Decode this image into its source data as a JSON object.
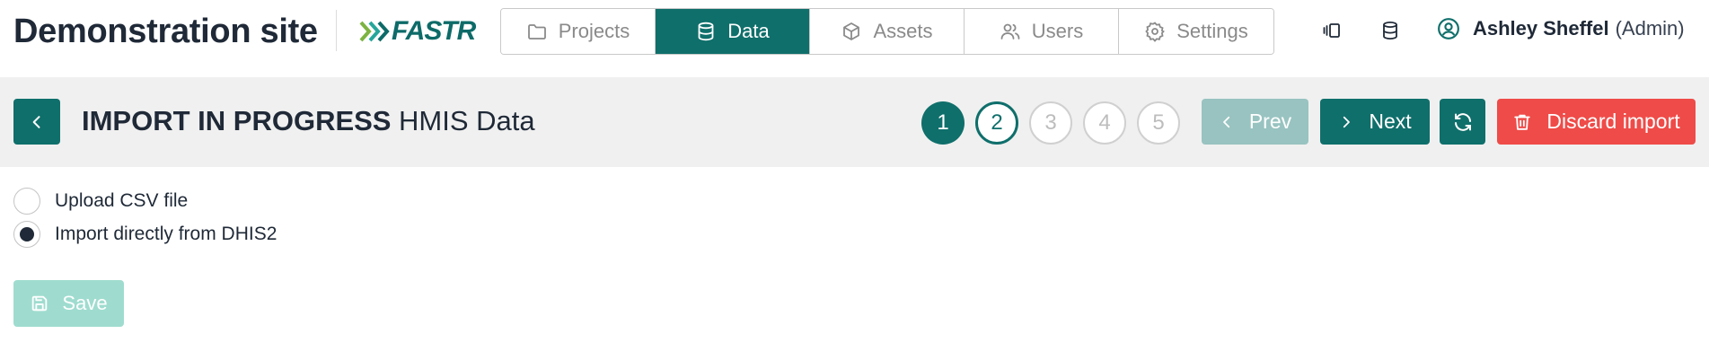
{
  "header": {
    "site_title": "Demonstration site",
    "logo_text": "FASTR",
    "tabs": [
      {
        "label": "Projects",
        "icon": "folder-icon",
        "active": false
      },
      {
        "label": "Data",
        "icon": "database-icon",
        "active": true
      },
      {
        "label": "Assets",
        "icon": "box-icon",
        "active": false
      },
      {
        "label": "Users",
        "icon": "users-icon",
        "active": false
      },
      {
        "label": "Settings",
        "icon": "gear-icon",
        "active": false
      }
    ],
    "user": {
      "name": "Ashley Sheffel",
      "role": "(Admin)"
    }
  },
  "import": {
    "status_title": "IMPORT IN PROGRESS",
    "dataset": "HMIS Data",
    "steps": [
      "1",
      "2",
      "3",
      "4",
      "5"
    ],
    "current_step": 2,
    "prev_label": "Prev",
    "next_label": "Next",
    "discard_label": "Discard import"
  },
  "source_options": [
    {
      "label": "Upload CSV file",
      "selected": false
    },
    {
      "label": "Import directly from DHIS2",
      "selected": true
    }
  ],
  "save_label": "Save",
  "colors": {
    "primary": "#0f6f6b",
    "danger": "#ef4b48",
    "disabled_primary": "#98c3c0",
    "save_disabled": "#9fdccf",
    "band": "#f0f0f0"
  }
}
